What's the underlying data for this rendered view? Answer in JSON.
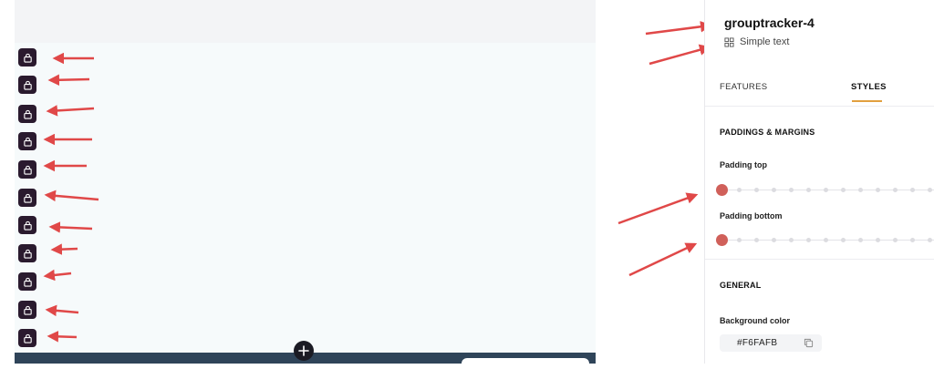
{
  "canvas": {
    "background": "#F6FAFB",
    "lock_count": 11,
    "add_button_icon": "plus-icon",
    "row_icon": "lock-icon"
  },
  "panel": {
    "title": "grouptracker-4",
    "subtitle": "Simple text",
    "subtitle_icon": "grid-icon",
    "tabs": [
      {
        "label": "FEATURES",
        "active": false
      },
      {
        "label": "STYLES",
        "active": true
      }
    ],
    "sections": {
      "paddings": {
        "heading": "PADDINGS & MARGINS",
        "padding_top_label": "Padding top",
        "padding_bottom_label": "Padding bottom",
        "padding_top_value": 0,
        "padding_bottom_value": 0
      },
      "general": {
        "heading": "GENERAL",
        "bg_color_label": "Background color",
        "bg_color_value": "#F6FAFB",
        "copy_icon": "copy-icon"
      }
    }
  },
  "colors": {
    "accent": "#E2A03F",
    "slider_thumb": "#D0605A",
    "annotation_arrow": "#E04848",
    "lock_button": "#2A1A2E",
    "bottom_bar": "#2F4459"
  }
}
